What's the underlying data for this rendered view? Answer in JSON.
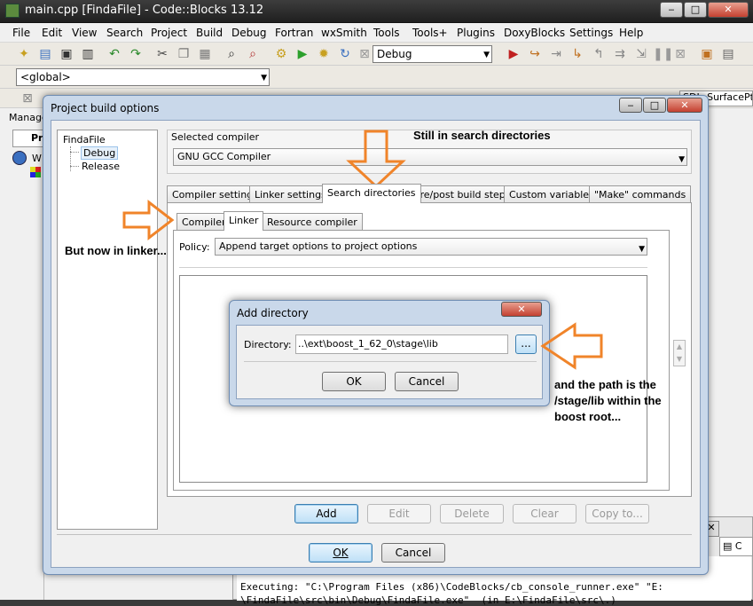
{
  "window": {
    "title": "main.cpp [FindaFile] - Code::Blocks 13.12"
  },
  "menu": [
    "File",
    "Edit",
    "View",
    "Search",
    "Project",
    "Build",
    "Debug",
    "Fortran",
    "wxSmith",
    "Tools",
    "Tools+",
    "Plugins",
    "DoxyBlocks",
    "Settings",
    "Help"
  ],
  "toolbar": {
    "build_target": "Debug",
    "scope": "<global>",
    "right_snippet": "SDL_SurfacePtr"
  },
  "side": {
    "manage_label": "Manage",
    "tab_label": "Pr",
    "ws_label": "W"
  },
  "console": {
    "line1": "Executing: \"C:\\Program Files (x86)\\CodeBlocks/cb_console_runner.exe\" \"E:",
    "line2": "\\FindaFile\\src\\bin\\Debug\\FindaFile.exe\"  (in E:\\FindaFile\\src\\.)"
  },
  "pbo": {
    "title": "Project build options",
    "tree": {
      "root": "FindaFile",
      "children": [
        "Debug",
        "Release"
      ]
    },
    "selected_compiler_label": "Selected compiler",
    "compiler": "GNU GCC Compiler",
    "tabs": [
      "Compiler settings",
      "Linker settings",
      "Search directories",
      "Pre/post build steps",
      "Custom variables",
      "\"Make\" commands"
    ],
    "subtabs": [
      "Compiler",
      "Linker",
      "Resource compiler"
    ],
    "policy_label": "Policy:",
    "policy_value": "Append target options to project options",
    "buttons": {
      "add": "Add",
      "edit": "Edit",
      "delete": "Delete",
      "clear": "Clear",
      "copy": "Copy to..."
    },
    "ok": "OK",
    "cancel": "Cancel"
  },
  "adddir": {
    "title": "Add directory",
    "directory_label": "Directory:",
    "directory_value": "..\\ext\\boost_1_62_0\\stage\\lib",
    "browse": "...",
    "ok": "OK",
    "cancel": "Cancel"
  },
  "annotations": {
    "top": "Still in search directories",
    "left": "But now in linker...",
    "right_line1": "and the path is the",
    "right_line2": "/stage/lib within the",
    "right_line3": "boost root...",
    "arrow_color": "#f0842a"
  }
}
